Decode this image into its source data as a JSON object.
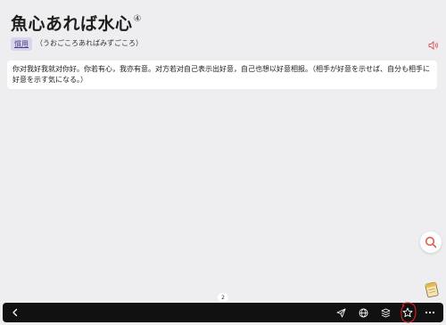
{
  "entry": {
    "headword": "魚心あれば水心",
    "superscript": "④",
    "tag": "慣用",
    "reading": "（うおごころあればみずごころ）",
    "meaning": "你对我好我就对你好。你若有心，我亦有意。对方若对自己表示出好意，自己也想以好意相报。（相手が好意を示せば、自分も相手に好意を示す気になる。）"
  },
  "pagination": {
    "page": "2"
  },
  "colors": {
    "background": "#eeeef0",
    "tag_bg": "#d9d6ec",
    "toolbar_bg": "#111111",
    "speaker": "#e05a5a",
    "search_icon": "#e25a48",
    "annotation": "#e0202a"
  },
  "icons": {
    "speaker": "speaker-icon",
    "search": "search-icon",
    "note": "notebook-icon",
    "back": "back-icon",
    "share": "send-icon",
    "globe": "globe-icon",
    "layers": "layers-icon",
    "favorite": "star-icon",
    "more": "more-icon"
  }
}
